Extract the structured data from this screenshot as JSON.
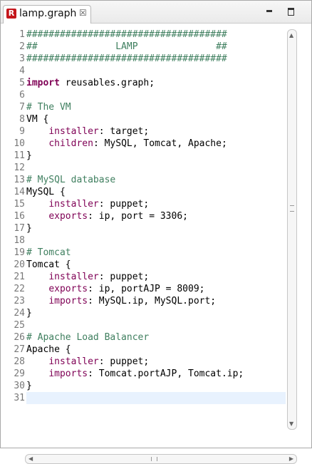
{
  "tab": {
    "title": "lamp.graph",
    "icon": "graph-file-icon",
    "close_glyph": "☒"
  },
  "window_controls": {
    "minimize": "minimize-icon",
    "maximize": "maximize-icon"
  },
  "editor": {
    "current_line": 31,
    "lines": [
      {
        "no": "1",
        "tokens": [
          {
            "t": "####################################",
            "c": "comment"
          }
        ]
      },
      {
        "no": "2",
        "tokens": [
          {
            "t": "##              LAMP              ##",
            "c": "comment"
          }
        ]
      },
      {
        "no": "3",
        "tokens": [
          {
            "t": "####################################",
            "c": "comment"
          }
        ]
      },
      {
        "no": "4",
        "tokens": []
      },
      {
        "no": "5",
        "tokens": [
          {
            "t": "import",
            "c": "kw"
          },
          {
            "t": " reusables.graph;",
            "c": ""
          }
        ]
      },
      {
        "no": "6",
        "tokens": []
      },
      {
        "no": "7",
        "tokens": [
          {
            "t": "# The VM",
            "c": "comment"
          }
        ]
      },
      {
        "no": "8",
        "tokens": [
          {
            "t": "VM {",
            "c": ""
          }
        ]
      },
      {
        "no": "9",
        "tokens": [
          {
            "t": "    ",
            "c": ""
          },
          {
            "t": "installer",
            "c": "prop"
          },
          {
            "t": ": target;",
            "c": ""
          }
        ]
      },
      {
        "no": "10",
        "tokens": [
          {
            "t": "    ",
            "c": ""
          },
          {
            "t": "children",
            "c": "prop"
          },
          {
            "t": ": MySQL, Tomcat, Apache;",
            "c": ""
          }
        ]
      },
      {
        "no": "11",
        "tokens": [
          {
            "t": "}",
            "c": ""
          }
        ]
      },
      {
        "no": "12",
        "tokens": []
      },
      {
        "no": "13",
        "tokens": [
          {
            "t": "# MySQL database",
            "c": "comment"
          }
        ]
      },
      {
        "no": "14",
        "tokens": [
          {
            "t": "MySQL {",
            "c": ""
          }
        ]
      },
      {
        "no": "15",
        "tokens": [
          {
            "t": "    ",
            "c": ""
          },
          {
            "t": "installer",
            "c": "prop"
          },
          {
            "t": ": puppet;",
            "c": ""
          }
        ]
      },
      {
        "no": "16",
        "tokens": [
          {
            "t": "    ",
            "c": ""
          },
          {
            "t": "exports",
            "c": "prop"
          },
          {
            "t": ": ip, port = 3306;",
            "c": ""
          }
        ]
      },
      {
        "no": "17",
        "tokens": [
          {
            "t": "}",
            "c": ""
          }
        ]
      },
      {
        "no": "18",
        "tokens": []
      },
      {
        "no": "19",
        "tokens": [
          {
            "t": "# Tomcat",
            "c": "comment"
          }
        ]
      },
      {
        "no": "20",
        "tokens": [
          {
            "t": "Tomcat {",
            "c": ""
          }
        ]
      },
      {
        "no": "21",
        "tokens": [
          {
            "t": "    ",
            "c": ""
          },
          {
            "t": "installer",
            "c": "prop"
          },
          {
            "t": ": puppet;",
            "c": ""
          }
        ]
      },
      {
        "no": "22",
        "tokens": [
          {
            "t": "    ",
            "c": ""
          },
          {
            "t": "exports",
            "c": "prop"
          },
          {
            "t": ": ip, portAJP = 8009;",
            "c": ""
          }
        ]
      },
      {
        "no": "23",
        "tokens": [
          {
            "t": "    ",
            "c": ""
          },
          {
            "t": "imports",
            "c": "prop"
          },
          {
            "t": ": MySQL.ip, MySQL.port;",
            "c": ""
          }
        ]
      },
      {
        "no": "24",
        "tokens": [
          {
            "t": "}",
            "c": ""
          }
        ]
      },
      {
        "no": "25",
        "tokens": []
      },
      {
        "no": "26",
        "tokens": [
          {
            "t": "# Apache Load Balancer",
            "c": "comment"
          }
        ]
      },
      {
        "no": "27",
        "tokens": [
          {
            "t": "Apache {",
            "c": ""
          }
        ]
      },
      {
        "no": "28",
        "tokens": [
          {
            "t": "    ",
            "c": ""
          },
          {
            "t": "installer",
            "c": "prop"
          },
          {
            "t": ": puppet;",
            "c": ""
          }
        ]
      },
      {
        "no": "29",
        "tokens": [
          {
            "t": "    ",
            "c": ""
          },
          {
            "t": "imports",
            "c": "prop"
          },
          {
            "t": ": Tomcat.portAJP, Tomcat.ip;",
            "c": ""
          }
        ]
      },
      {
        "no": "30",
        "tokens": [
          {
            "t": "}",
            "c": ""
          }
        ]
      },
      {
        "no": "31",
        "tokens": []
      }
    ]
  },
  "colors": {
    "keyword": "#7f0055",
    "comment": "#3f7f5f",
    "line_number": "#787878",
    "current_line_highlight": "#e8f2fe"
  }
}
